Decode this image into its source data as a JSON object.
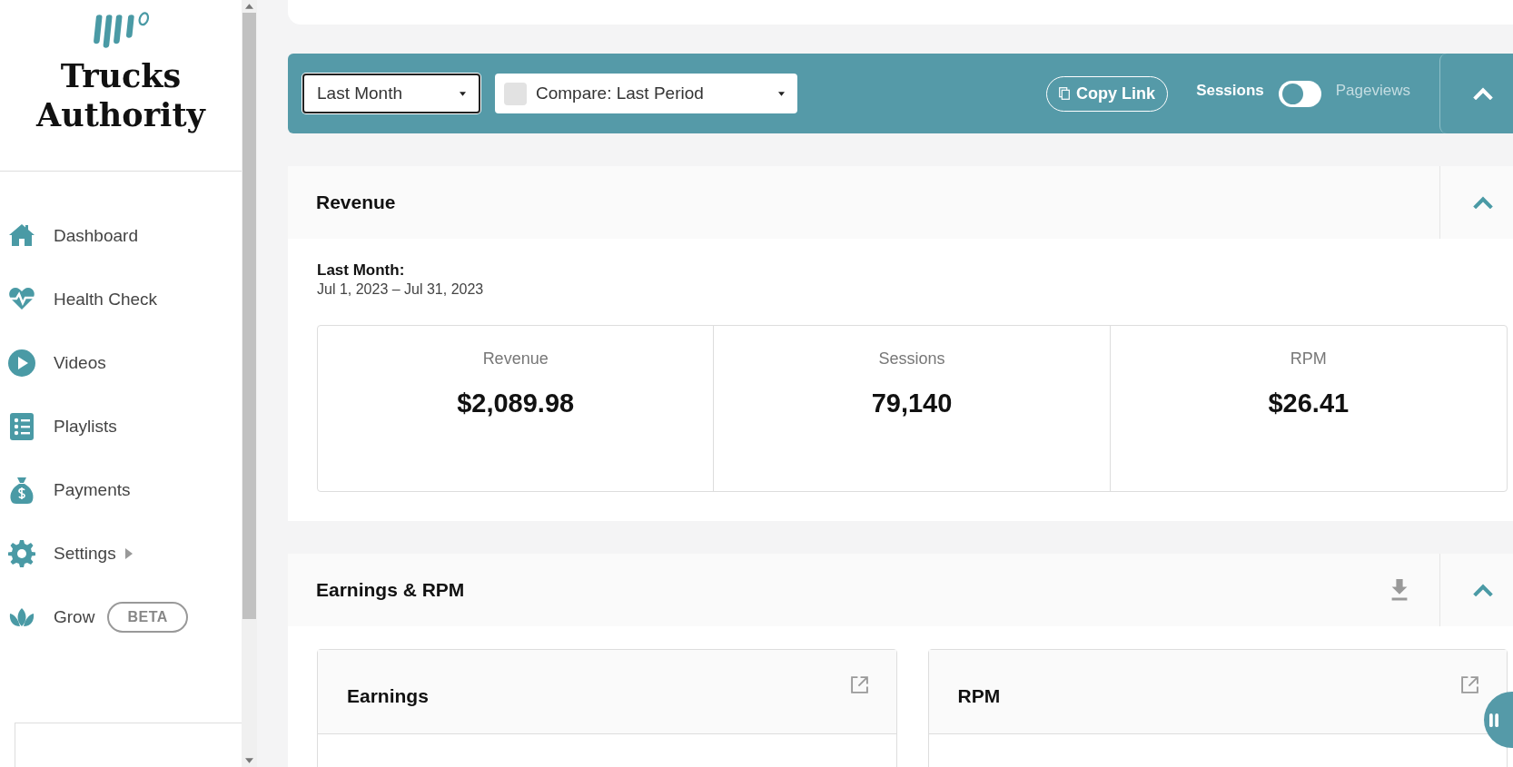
{
  "sidebar": {
    "site_name": "Trucks Authority",
    "items": [
      {
        "label": "Dashboard",
        "kind": "home",
        "selected": false
      },
      {
        "label": "Health Check",
        "kind": "heart",
        "selected": false
      },
      {
        "label": "Videos",
        "kind": "play",
        "selected": false
      },
      {
        "label": "Playlists",
        "kind": "list",
        "selected": false
      },
      {
        "label": "Payments",
        "kind": "bag",
        "selected": false
      },
      {
        "label": "Settings",
        "kind": "gear",
        "selected": false,
        "submenu": true
      },
      {
        "label": "Grow",
        "kind": "leaf",
        "selected": false,
        "badge": "BETA"
      }
    ]
  },
  "filter_bar": {
    "period": {
      "value": "Last Month"
    },
    "compare": {
      "value": "Compare: Last Period",
      "checked": false
    },
    "copy_link": "Copy Link",
    "metric_toggle": {
      "on": false,
      "left_label": "Sessions",
      "right_label": "Pageviews"
    }
  },
  "revenue": {
    "title": "Revenue",
    "expanded": true,
    "range_label": "Last Month:",
    "range": "Jul 1, 2023 – Jul 31, 2023",
    "stats": [
      {
        "label": "Revenue",
        "value": "$2,089.98"
      },
      {
        "label": "Sessions",
        "value": "79,140"
      },
      {
        "label": "RPM",
        "value": "$26.41"
      }
    ]
  },
  "earnings_rpm": {
    "title": "Earnings & RPM",
    "expanded": true,
    "cards": [
      {
        "title": "Earnings"
      },
      {
        "title": "RPM"
      }
    ]
  }
}
